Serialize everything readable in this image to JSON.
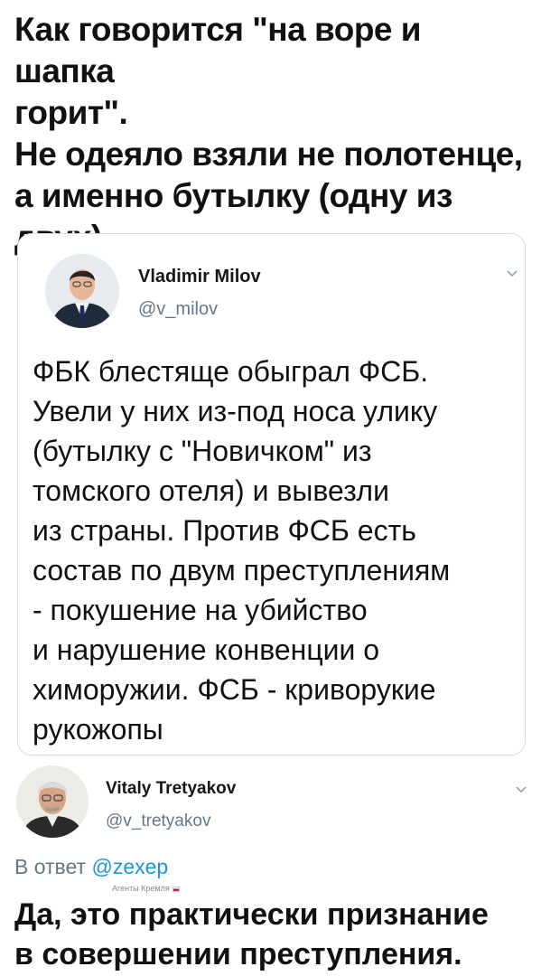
{
  "header_tweet": {
    "text": "Как говорится \"на воре и шапка\nгорит\".\nНе одеяло взяли не полотенце,\nа именно бутылку (одну из\nдвух)."
  },
  "quoted_tweet": {
    "author_name": "Vladimir Milov",
    "author_handle": "@v_milov",
    "body": "ФБК блестяще обыграл ФСБ.\nУвели у них из-под носа улику\n(бутылку с \"Новичком\" из\nтомского отеля) и вывезли\nиз страны. Против ФСБ есть\nсостав по двум преступлениям\n- покушение на убийство\nи нарушение конвенции о\nхиморужии. ФСБ - криворукие\nрукожопы",
    "menu_icon": "chevron-down-icon"
  },
  "reply_tweet": {
    "author_name": "Vitaly Tretyakov",
    "author_handle": "@v_tretyakov",
    "reply_prefix": "В ответ",
    "reply_mention": "@zexep",
    "agency_label": "Агенты Кремля",
    "body": "Да, это практически признание\nв совершении преступления.",
    "menu_icon": "chevron-down-icon"
  },
  "colors": {
    "text": "#14171a",
    "secondary": "#657786",
    "link": "#1b95e0",
    "border": "#d8dde1"
  }
}
